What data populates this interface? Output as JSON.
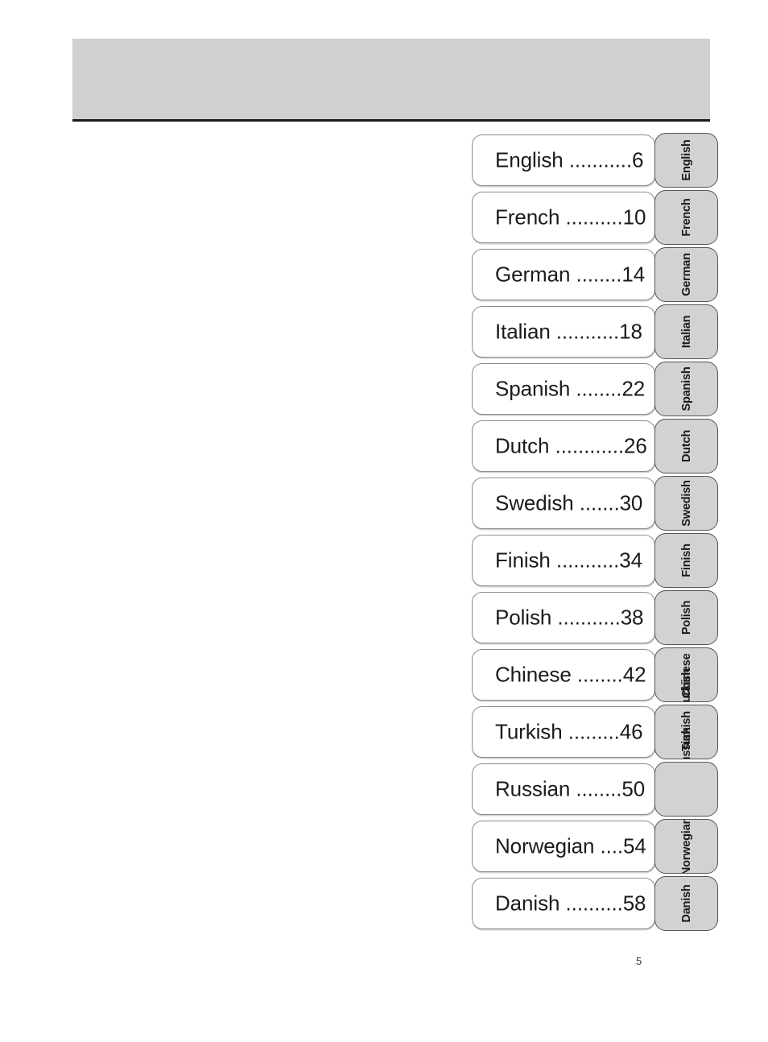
{
  "page": {
    "number": "5",
    "header_band_color": "#d0d0d0",
    "tab_color": "#d2d2d2",
    "text_color": "#1b1b1b"
  },
  "toc": {
    "rows": [
      {
        "label": "English ...........6",
        "language": "English",
        "page": "6",
        "tab": "English",
        "tab_mode": "normal"
      },
      {
        "label": "French ..........10",
        "language": "French",
        "page": "10",
        "tab": "French",
        "tab_mode": "normal"
      },
      {
        "label": "German ........14",
        "language": "German",
        "page": "14",
        "tab": "German",
        "tab_mode": "normal"
      },
      {
        "label": "Italian ...........18",
        "language": "Italian",
        "page": "18",
        "tab": "Italian",
        "tab_mode": "normal"
      },
      {
        "label": "Spanish ........22",
        "language": "Spanish",
        "page": "22",
        "tab": "Spanish",
        "tab_mode": "normal"
      },
      {
        "label": "Dutch ............26",
        "language": "Dutch",
        "page": "26",
        "tab": "Dutch",
        "tab_mode": "normal"
      },
      {
        "label": "Swedish .......30",
        "language": "Swedish",
        "page": "30",
        "tab": "Swedish",
        "tab_mode": "normal"
      },
      {
        "label": "Finish ...........34",
        "language": "Finish",
        "page": "34",
        "tab": "Finish",
        "tab_mode": "normal"
      },
      {
        "label": "Polish ...........38",
        "language": "Polish",
        "page": "38",
        "tab": "Polish",
        "tab_mode": "normal"
      },
      {
        "label": "Chinese ........42",
        "language": "Chinese",
        "page": "42",
        "tab": "Chinese",
        "tab_mode": "overlap",
        "tab_overlay": "Turkish"
      },
      {
        "label": "Turkish .........46",
        "language": "Turkish",
        "page": "46",
        "tab": "Turkish",
        "tab_mode": "overlap2",
        "tab_overlay": "Russian"
      },
      {
        "label": "Russian ........50",
        "language": "Russian",
        "page": "50",
        "tab": "",
        "tab_mode": "blank"
      },
      {
        "label": "Norwegian ....54",
        "language": "Norwegian",
        "page": "54",
        "tab": "Norwegian",
        "tab_mode": "normal"
      },
      {
        "label": "Danish ..........58",
        "language": "Danish",
        "page": "58",
        "tab": "Danish",
        "tab_mode": "normal"
      }
    ]
  }
}
